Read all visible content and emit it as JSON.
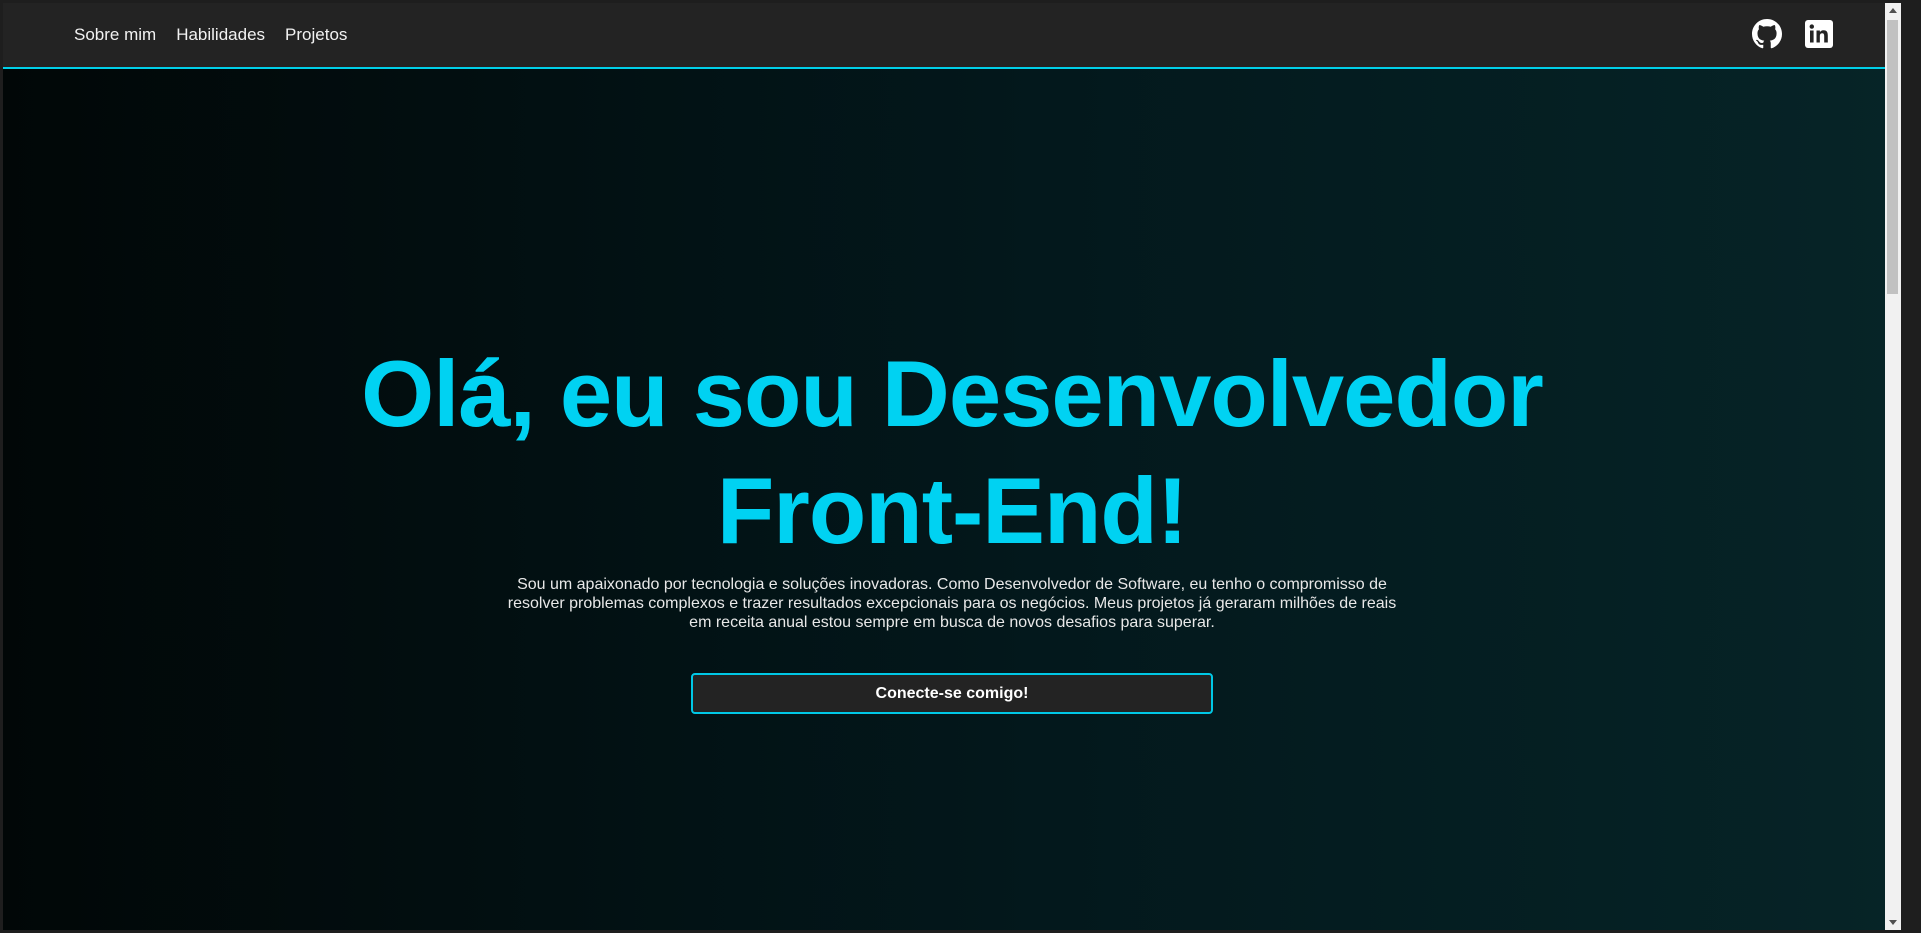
{
  "nav": {
    "links": [
      {
        "label": "Sobre mim"
      },
      {
        "label": "Habilidades"
      },
      {
        "label": "Projetos"
      }
    ],
    "icons": [
      "github-icon",
      "linkedin-icon"
    ]
  },
  "hero": {
    "title": "Olá, eu sou Desenvolvedor Front-End!",
    "description": "Sou um apaixonado por tecnologia e soluções inovadoras. Como Desenvolvedor de Software, eu tenho o compromisso de resolver problemas complexos e trazer resultados excepcionais para os negócios. Meus projetos já geraram milhões de reais em receita anual estou sempre em busca de novos desafios para superar.",
    "cta_label": "Conecte-se comigo!"
  },
  "colors": {
    "accent": "#00d2f2",
    "navbar_bg": "#232323",
    "hero_bg_start": "#010707",
    "hero_bg_end": "#062427",
    "text": "#f2f2f2"
  }
}
